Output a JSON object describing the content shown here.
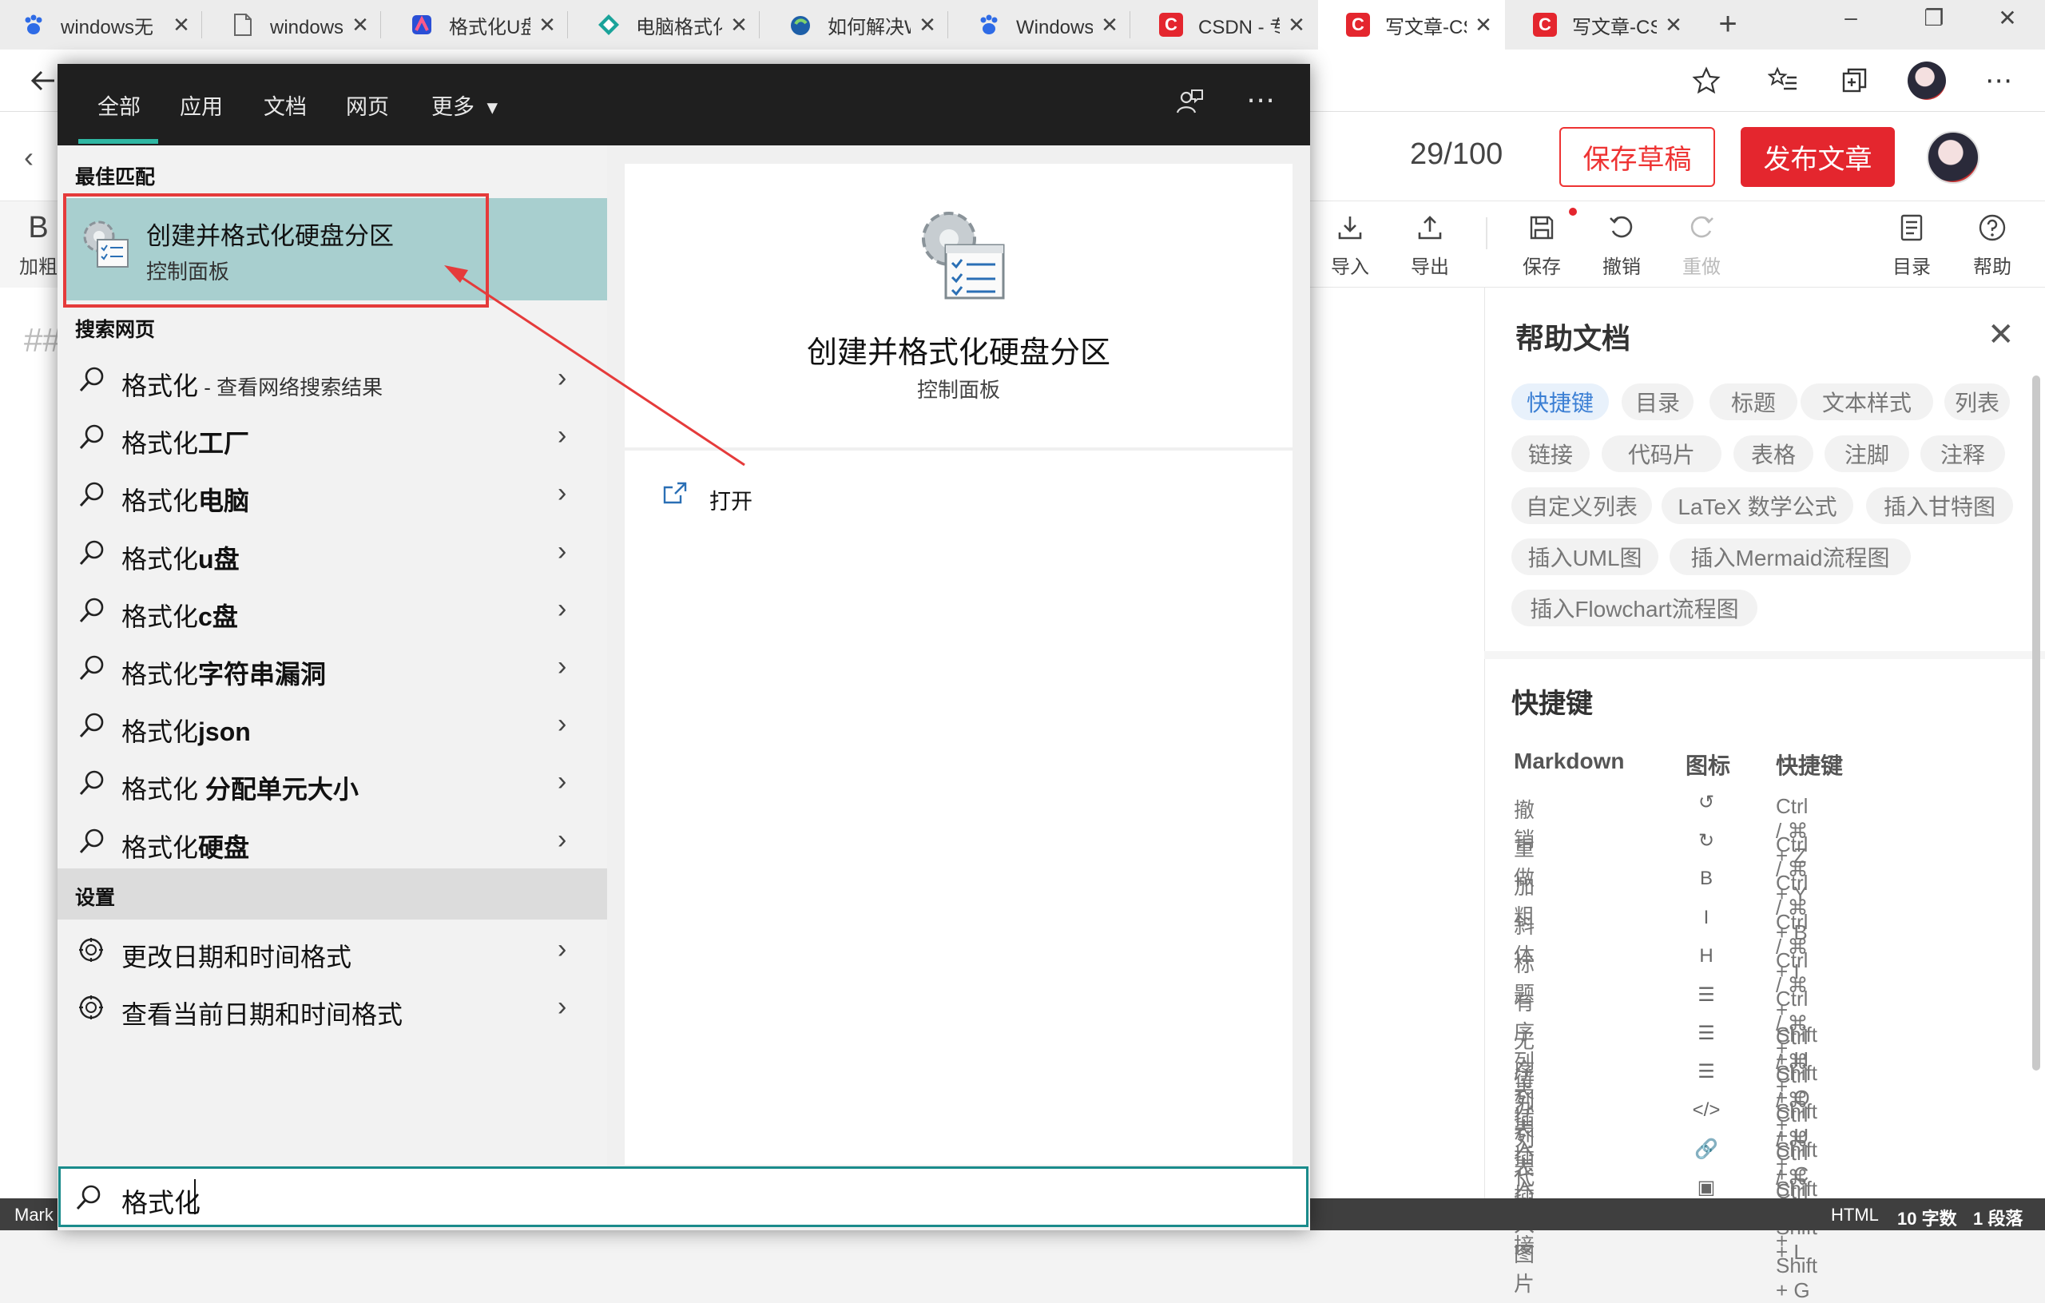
{
  "browser": {
    "tabs": [
      {
        "title": "windows无",
        "icon": "baidu-paw-icon",
        "color": "#2e6be6"
      },
      {
        "title": "windows无",
        "icon": "document-icon",
        "color": "#666666"
      },
      {
        "title": "格式化U盘",
        "icon": "app-icon",
        "color": "#2a4fd6"
      },
      {
        "title": "电脑格式化",
        "icon": "diamond-icon",
        "color": "#1aa39a"
      },
      {
        "title": "如何解决W",
        "icon": "globe-bird-icon",
        "color": "#1d5fa8"
      },
      {
        "title": "Windows如",
        "icon": "baidu-paw-icon",
        "color": "#2e6be6"
      },
      {
        "title": "CSDN - 专",
        "icon": "csdn-icon",
        "color": "#e4262e"
      },
      {
        "title": "写文章-CS",
        "icon": "csdn-icon",
        "color": "#e4262e"
      },
      {
        "title": "写文章-CS",
        "icon": "csdn-icon",
        "color": "#e4262e"
      }
    ],
    "active_tab": 7,
    "new_tab": "+"
  },
  "editor": {
    "word_count": "29/100",
    "save_draft": "保存草稿",
    "publish": "发布文章",
    "tools": {
      "bold_glyph": "B",
      "bold": "加粗",
      "import": "导入",
      "export": "导出",
      "save": "保存",
      "undo": "撤销",
      "redo": "重做",
      "toc": "目录",
      "help": "帮助"
    },
    "heading_mark": "##",
    "status": {
      "left": "Mark",
      "html": "HTML",
      "words": "10 字数",
      "paragraphs": "1 段落"
    }
  },
  "help_panel": {
    "title": "帮助文档",
    "chips": [
      "快捷键",
      "目录",
      "标题",
      "文本样式",
      "列表",
      "链接",
      "代码片",
      "表格",
      "注脚",
      "注释",
      "自定义列表",
      "LaTeX 数学公式",
      "插入甘特图",
      "插入UML图",
      "插入Mermaid流程图",
      "插入Flowchart流程图"
    ],
    "active_chip": "快捷键",
    "shortcuts_title": "快捷键",
    "headers": [
      "Markdown",
      "图标",
      "快捷键"
    ],
    "rows": [
      {
        "name": "撤销",
        "icon": "↺",
        "keys": "Ctrl / ⌘ + Z"
      },
      {
        "name": "重做",
        "icon": "↻",
        "keys": "Ctrl / ⌘ + Y"
      },
      {
        "name": "加粗",
        "icon": "B",
        "keys": "Ctrl / ⌘ + B"
      },
      {
        "name": "斜体",
        "icon": "I",
        "keys": "Ctrl / ⌘ + I"
      },
      {
        "name": "标题",
        "icon": "H",
        "keys": "Ctrl / ⌘ + Shift + H"
      },
      {
        "name": "有序列表",
        "icon": "☰",
        "keys": "Ctrl / ⌘ + Shift + O"
      },
      {
        "name": "无序列表",
        "icon": "☰",
        "keys": "Ctrl / ⌘ + Shift + U"
      },
      {
        "name": "待办列表",
        "icon": "☰",
        "keys": "Ctrl / ⌘ + Shift + C"
      },
      {
        "name": "插入代码",
        "icon": "</>",
        "keys": "Ctrl / ⌘ + Shift + K"
      },
      {
        "name": "插入链接",
        "icon": "🔗",
        "keys": "Ctrl / ⌘ + Shift + L"
      },
      {
        "name": "插入图片",
        "icon": "▣",
        "keys": "Ctrl / ⌘ + Shift + G"
      }
    ]
  },
  "search": {
    "tabs": [
      "全部",
      "应用",
      "文档",
      "网页",
      "更多"
    ],
    "more_arrow": "▾",
    "best_match_label": "最佳匹配",
    "best_match": {
      "title": "创建并格式化硬盘分区",
      "subtitle": "控制面板"
    },
    "web_label": "搜索网页",
    "web_results": [
      {
        "prefix": "格式化",
        "bold": "",
        "suffix": " - 查看网络搜索结果"
      },
      {
        "prefix": "格式化",
        "bold": "工厂",
        "suffix": ""
      },
      {
        "prefix": "格式化",
        "bold": "电脑",
        "suffix": ""
      },
      {
        "prefix": "格式化",
        "bold": "u盘",
        "suffix": ""
      },
      {
        "prefix": "格式化",
        "bold": "c盘",
        "suffix": ""
      },
      {
        "prefix": "格式化",
        "bold": "字符串漏洞",
        "suffix": ""
      },
      {
        "prefix": "格式化",
        "bold": "json",
        "suffix": ""
      },
      {
        "prefix": "格式化",
        "bold": " 分配单元大小",
        "suffix": ""
      },
      {
        "prefix": "格式化",
        "bold": "硬盘",
        "suffix": ""
      }
    ],
    "settings_label": "设置",
    "settings_results": [
      "更改日期和时间格式",
      "查看当前日期和时间格式"
    ],
    "detail": {
      "title": "创建并格式化硬盘分区",
      "subtitle": "控制面板",
      "action": "打开"
    },
    "query": "格式化"
  },
  "colors": {
    "accent_teal": "#2fb7a3",
    "highlight_red": "#e53b3b",
    "selection_bg": "#a8cfcf",
    "csdn_red": "#e4262e"
  }
}
